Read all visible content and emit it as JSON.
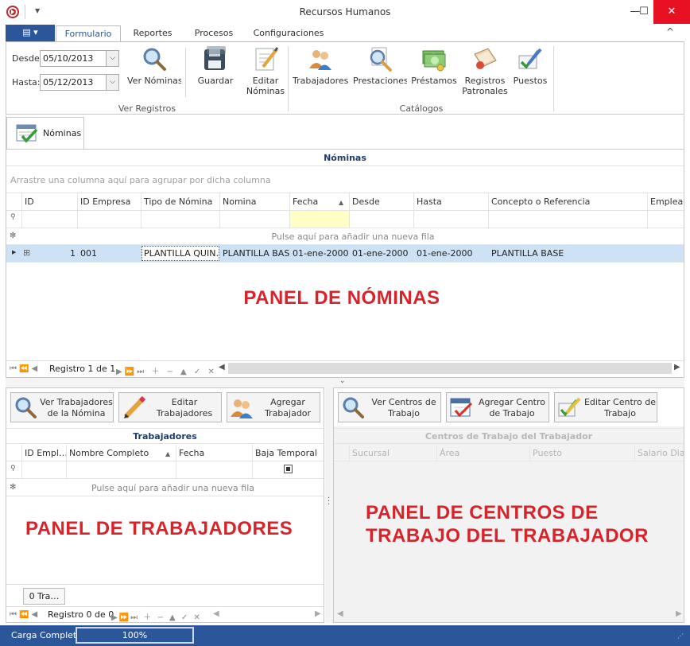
{
  "window": {
    "title": "Recursos Humanos",
    "minimize": "—",
    "maximize": "☐",
    "close": "✕"
  },
  "ribbon": {
    "file_button": "▤ ▾",
    "tabs": [
      "Formulario",
      "Reportes",
      "Procesos",
      "Configuraciones"
    ],
    "collapse": "^",
    "desde_label": "Desde:",
    "desde_value": "05/10/2013",
    "hasta_label": "Hasta:",
    "hasta_value": "05/12/2013",
    "ver_nominas": "Ver Nóminas",
    "guardar": "Guardar",
    "editar_nominas": [
      "Editar",
      "Nóminas"
    ],
    "group_ver_registros": "Ver Registros",
    "trabajadores": "Trabajadores",
    "prestaciones": "Prestaciones",
    "prestamos": "Préstamos",
    "registros_patronales": [
      "Registros",
      "Patronales"
    ],
    "puestos": "Puestos",
    "group_catalogos": "Catálogos"
  },
  "doc_tab": {
    "label": "Nóminas"
  },
  "nominas": {
    "header": "Nóminas",
    "group_hint": "Arrastre una columna aquí para agrupar por dicha columna",
    "columns": [
      "ID",
      "ID Empresa",
      "Tipo de Nómina",
      "Nomina",
      "Fecha",
      "Desde",
      "Hasta",
      "Concepto o Referencia",
      "Empleado"
    ],
    "new_row": "Pulse aquí para añadir una nueva fila",
    "row": {
      "expand": "⊞",
      "id": "1",
      "empresa": "001",
      "tipo": "PLANTILLA QUIN…",
      "nomina": "PLANTILLA BASE",
      "fecha": "01-ene-2000",
      "desde": "01-ene-2000",
      "hasta": "01-ene-2000",
      "concepto": "PLANTILLA BASE"
    },
    "overlay": "PANEL DE NÓMINAS",
    "record": "Registro 1 de 1"
  },
  "trabajadores_panel": {
    "btn_ver": [
      "Ver Trabajadores",
      "de la Nómina"
    ],
    "btn_editar": [
      "Editar",
      "Trabajadores"
    ],
    "btn_agregar": [
      "Agregar",
      "Trabajador"
    ],
    "header": "Trabajadores",
    "columns": [
      "ID Empl…",
      "Nombre Completo",
      "Fecha",
      "Baja Temporal"
    ],
    "new_row": "Pulse aquí para añadir una nueva fila",
    "overlay": "PANEL DE TRABAJADORES",
    "count_tab": "0 Tra…",
    "record": "Registro 0 de 0"
  },
  "centros_panel": {
    "btn_ver": [
      "Ver Centros de",
      "Trabajo"
    ],
    "btn_agregar": [
      "Agregar Centro",
      "de Trabajo"
    ],
    "btn_editar": [
      "Editar Centro de",
      "Trabajo"
    ],
    "header": "Centros de Trabajo del Trabajador",
    "columns": [
      "Sucursal",
      "Área",
      "Puesto",
      "Salario Diario"
    ],
    "overlay": [
      "PANEL DE CENTROS DE",
      "TRABAJO DEL TRABAJADOR"
    ]
  },
  "status": {
    "label": "Carga Completa",
    "progress_text": "100%",
    "progress": 1.0
  },
  "colors": {
    "accent": "#2b579a",
    "selected_row": "#cde3f5",
    "filter_hl": "#ffffc6",
    "overlay_red": "#d8232a",
    "close": "#e81123"
  }
}
